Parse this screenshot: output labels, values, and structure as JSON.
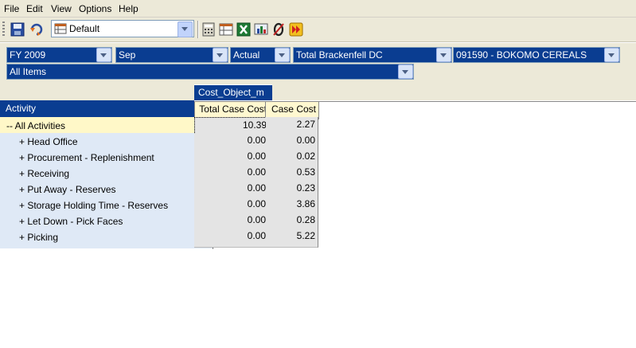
{
  "menu": [
    "File",
    "Edit",
    "View",
    "Options",
    "Help"
  ],
  "toolbar": {
    "layout_value": "Default",
    "buttons": [
      "save-icon",
      "refresh-icon",
      "layout-grid-icon",
      "calculator-icon",
      "table-view-icon",
      "excel-export-icon",
      "chart-export-icon",
      "zero-suppress-icon",
      "run-forward-icon"
    ]
  },
  "filters": {
    "year": "FY 2009",
    "month": "Sep",
    "scenario": "Actual",
    "site": "Total Brackenfell DC",
    "product": "091590 - BOKOMO CEREALS",
    "items": "All Items"
  },
  "grid": {
    "measure_tab": "Cost_Object_m",
    "row_header": "Activity",
    "columns": [
      "Total Case Cost",
      "Case Cost"
    ],
    "rows": [
      {
        "label": "-- All Activities",
        "values": [
          "10.39",
          "2.27"
        ]
      },
      {
        "label": "+ Head Office",
        "values": [
          "0.00",
          "0.00"
        ]
      },
      {
        "label": "+ Procurement - Replenishment",
        "values": [
          "0.00",
          "0.02"
        ]
      },
      {
        "label": "+ Receiving",
        "values": [
          "0.00",
          "0.53"
        ]
      },
      {
        "label": "+ Put Away - Reserves",
        "values": [
          "0.00",
          "0.23"
        ]
      },
      {
        "label": "+ Storage Holding Time - Reserves",
        "values": [
          "0.00",
          "3.86"
        ]
      },
      {
        "label": "+ Let Down - Pick Faces",
        "values": [
          "0.00",
          "0.28"
        ]
      },
      {
        "label": "+ Picking",
        "values": [
          "0.00",
          "5.22"
        ]
      }
    ]
  }
}
